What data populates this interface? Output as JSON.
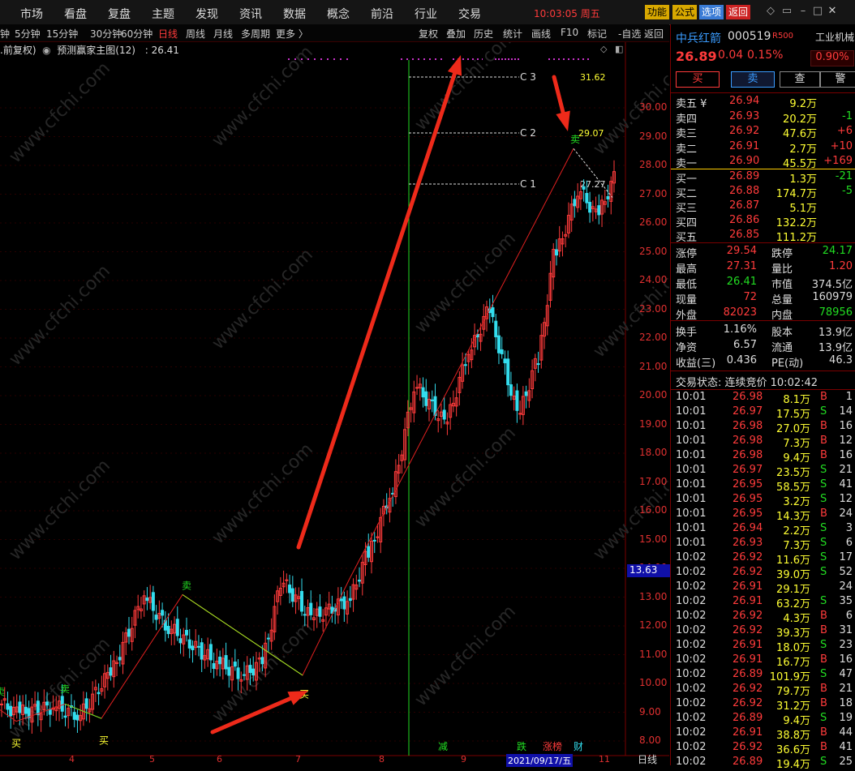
{
  "menu": {
    "items": [
      "市场",
      "看盘",
      "复盘",
      "主题",
      "发现",
      "资讯",
      "数据",
      "概念",
      "前沿",
      "行业",
      "交易"
    ],
    "clock": "10:03:05 周五",
    "buttons": [
      {
        "label": "功能",
        "bg": "#d8a800",
        "fg": "#000"
      },
      {
        "label": "公式",
        "bg": "#d8a800",
        "fg": "#000"
      },
      {
        "label": "选项",
        "bg": "#3a7bd5",
        "fg": "#fff"
      },
      {
        "label": "返回",
        "bg": "#cc2222",
        "fg": "#fff"
      }
    ]
  },
  "periods": {
    "items": [
      "钟",
      "5分钟",
      "15分钟",
      "30分钟",
      "60分钟",
      "日线",
      "周线",
      "月线",
      "多周期",
      "更多 〉"
    ],
    "active": "日线",
    "tools": [
      "复权",
      "叠加",
      "历史",
      "统计",
      "画线",
      "F10",
      "标记",
      "-自选",
      "返回"
    ]
  },
  "chart": {
    "info_prefix": ".前复权)",
    "indicator": "预测赢家主图(12)",
    "indicator_value": ": 26.41",
    "watermark": "www.cfchi.com",
    "price_label": "13.63",
    "signals": {
      "sell": "卖",
      "buy": "买"
    },
    "levels": [
      {
        "name": "C 3",
        "value": "31.62"
      },
      {
        "name": "C 2",
        "value": "29.07"
      },
      {
        "name": "C 1",
        "value": "27.27"
      }
    ],
    "y_ticks": [
      "30.00",
      "29.00",
      "28.00",
      "27.00",
      "26.00",
      "25.00",
      "24.00",
      "23.00",
      "22.00",
      "21.00",
      "20.00",
      "19.00",
      "18.00",
      "17.00",
      "16.00",
      "15.00",
      "14.00",
      "13.00",
      "12.00",
      "11.00",
      "10.00",
      "9.00",
      "8.00"
    ],
    "x_ticks": [
      "4",
      "5",
      "6",
      "7",
      "8",
      "9",
      "2021/09/17/五",
      "11"
    ],
    "x_axis_label": "日线",
    "events": [
      "减",
      "跌",
      "涨榜",
      "财"
    ]
  },
  "quote": {
    "name": "中兵红箭",
    "code": "000519",
    "tag": "R500",
    "industry": "工业机械",
    "industry_change": "0.90%",
    "price": "26.89",
    "change": "0.04",
    "change_pct": "0.15%",
    "actions": [
      "买",
      "卖",
      "查",
      "警"
    ],
    "asks": [
      {
        "label": "卖五 ¥",
        "price": "26.94",
        "vol": "9.2万",
        "delta": ""
      },
      {
        "label": "卖四",
        "price": "26.93",
        "vol": "20.2万",
        "delta": "-1"
      },
      {
        "label": "卖三",
        "price": "26.92",
        "vol": "47.6万",
        "delta": "+6"
      },
      {
        "label": "卖二",
        "price": "26.91",
        "vol": "2.7万",
        "delta": "+10"
      },
      {
        "label": "卖一",
        "price": "26.90",
        "vol": "45.5万",
        "delta": "+169"
      }
    ],
    "bids": [
      {
        "label": "买一",
        "price": "26.89",
        "vol": "1.3万",
        "delta": "-21"
      },
      {
        "label": "买二",
        "price": "26.88",
        "vol": "174.7万",
        "delta": "-5"
      },
      {
        "label": "买三",
        "price": "26.87",
        "vol": "5.1万",
        "delta": ""
      },
      {
        "label": "买四",
        "price": "26.86",
        "vol": "132.2万",
        "delta": ""
      },
      {
        "label": "买五",
        "price": "26.85",
        "vol": "111.2万",
        "delta": ""
      }
    ],
    "stats": [
      [
        "涨停",
        "29.54",
        "跌停",
        "24.17"
      ],
      [
        "最高",
        "27.31",
        "量比",
        "1.20"
      ],
      [
        "最低",
        "26.41",
        "市值",
        "374.5亿"
      ],
      [
        "现量",
        "72",
        "总量",
        "160979"
      ],
      [
        "外盘",
        "82023",
        "内盘",
        "78956"
      ]
    ],
    "stats2": [
      [
        "换手",
        "1.16%",
        "股本",
        "13.9亿"
      ],
      [
        "净资",
        "6.57",
        "流通",
        "13.9亿"
      ],
      [
        "收益(三)",
        "0.436",
        "PE(动)",
        "46.3"
      ]
    ],
    "trade_status": "交易状态: 连续竞价 10:02:42",
    "ticks": [
      [
        "10:01",
        "26.98",
        "8.1万",
        "B",
        "1"
      ],
      [
        "10:01",
        "26.97",
        "17.5万",
        "S",
        "14"
      ],
      [
        "10:01",
        "26.98",
        "27.0万",
        "B",
        "16"
      ],
      [
        "10:01",
        "26.98",
        "7.3万",
        "B",
        "12"
      ],
      [
        "10:01",
        "26.98",
        "9.4万",
        "B",
        "16"
      ],
      [
        "10:01",
        "26.97",
        "23.5万",
        "S",
        "21"
      ],
      [
        "10:01",
        "26.95",
        "58.5万",
        "S",
        "41"
      ],
      [
        "10:01",
        "26.95",
        "3.2万",
        "S",
        "12"
      ],
      [
        "10:01",
        "26.95",
        "14.3万",
        "B",
        "24"
      ],
      [
        "10:01",
        "26.94",
        "2.2万",
        "S",
        "3"
      ],
      [
        "10:01",
        "26.93",
        "7.3万",
        "S",
        "6"
      ],
      [
        "10:02",
        "26.92",
        "11.6万",
        "S",
        "17"
      ],
      [
        "10:02",
        "26.92",
        "39.0万",
        "S",
        "52"
      ],
      [
        "10:02",
        "26.91",
        "29.1万",
        "",
        "24"
      ],
      [
        "10:02",
        "26.91",
        "63.2万",
        "S",
        "35"
      ],
      [
        "10:02",
        "26.92",
        "4.3万",
        "B",
        "6"
      ],
      [
        "10:02",
        "26.92",
        "39.3万",
        "B",
        "31"
      ],
      [
        "10:02",
        "26.91",
        "18.0万",
        "S",
        "23"
      ],
      [
        "10:02",
        "26.91",
        "16.7万",
        "B",
        "16"
      ],
      [
        "10:02",
        "26.89",
        "101.9万",
        "S",
        "47"
      ],
      [
        "10:02",
        "26.92",
        "79.7万",
        "B",
        "21"
      ],
      [
        "10:02",
        "26.92",
        "31.2万",
        "B",
        "18"
      ],
      [
        "10:02",
        "26.89",
        "9.4万",
        "S",
        "19"
      ],
      [
        "10:02",
        "26.91",
        "38.8万",
        "B",
        "44"
      ],
      [
        "10:02",
        "26.92",
        "36.6万",
        "B",
        "41"
      ],
      [
        "10:02",
        "26.89",
        "19.4万",
        "S",
        "25"
      ]
    ]
  }
}
